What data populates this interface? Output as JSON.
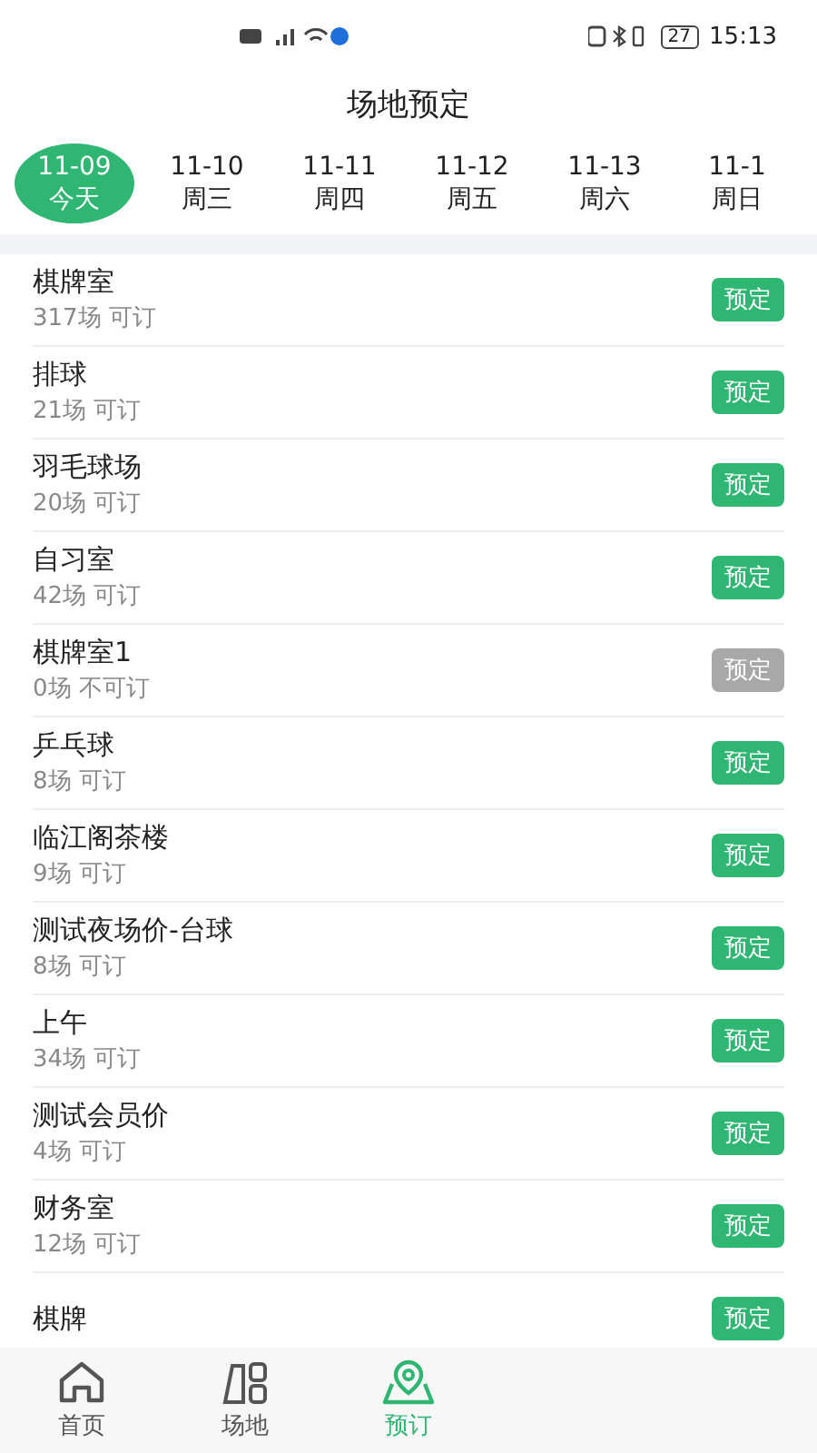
{
  "status_bar": {
    "battery": "27",
    "time": "15:13"
  },
  "title": "场地预定",
  "dates": [
    {
      "date": "11-09",
      "day": "今天",
      "selected": true
    },
    {
      "date": "11-10",
      "day": "周三",
      "selected": false
    },
    {
      "date": "11-11",
      "day": "周四",
      "selected": false
    },
    {
      "date": "11-12",
      "day": "周五",
      "selected": false
    },
    {
      "date": "11-13",
      "day": "周六",
      "selected": false
    },
    {
      "date": "11-1",
      "day": "周日",
      "selected": false
    }
  ],
  "venues": [
    {
      "name": "棋牌室",
      "availability": "317场 可订",
      "button": "预定",
      "disabled": false
    },
    {
      "name": "排球",
      "availability": "21场 可订",
      "button": "预定",
      "disabled": false
    },
    {
      "name": "羽毛球场",
      "availability": "20场 可订",
      "button": "预定",
      "disabled": false
    },
    {
      "name": "自习室",
      "availability": "42场 可订",
      "button": "预定",
      "disabled": false
    },
    {
      "name": "棋牌室1",
      "availability": "0场 不可订",
      "button": "预定",
      "disabled": true
    },
    {
      "name": "乒乓球",
      "availability": "8场 可订",
      "button": "预定",
      "disabled": false
    },
    {
      "name": "临江阁茶楼",
      "availability": "9场 可订",
      "button": "预定",
      "disabled": false
    },
    {
      "name": "测试夜场价-台球",
      "availability": "8场 可订",
      "button": "预定",
      "disabled": false
    },
    {
      "name": "上午",
      "availability": "34场 可订",
      "button": "预定",
      "disabled": false
    },
    {
      "name": "测试会员价",
      "availability": "4场 可订",
      "button": "预定",
      "disabled": false
    },
    {
      "name": "财务室",
      "availability": "12场 可订",
      "button": "预定",
      "disabled": false
    },
    {
      "name": "棋牌",
      "button": "预定",
      "disabled": false
    }
  ],
  "nav": [
    {
      "label": "首页",
      "kind": "home",
      "selected": false
    },
    {
      "label": "场地",
      "kind": "venue",
      "selected": false
    },
    {
      "label": "预订",
      "kind": "booking",
      "selected": true
    }
  ]
}
